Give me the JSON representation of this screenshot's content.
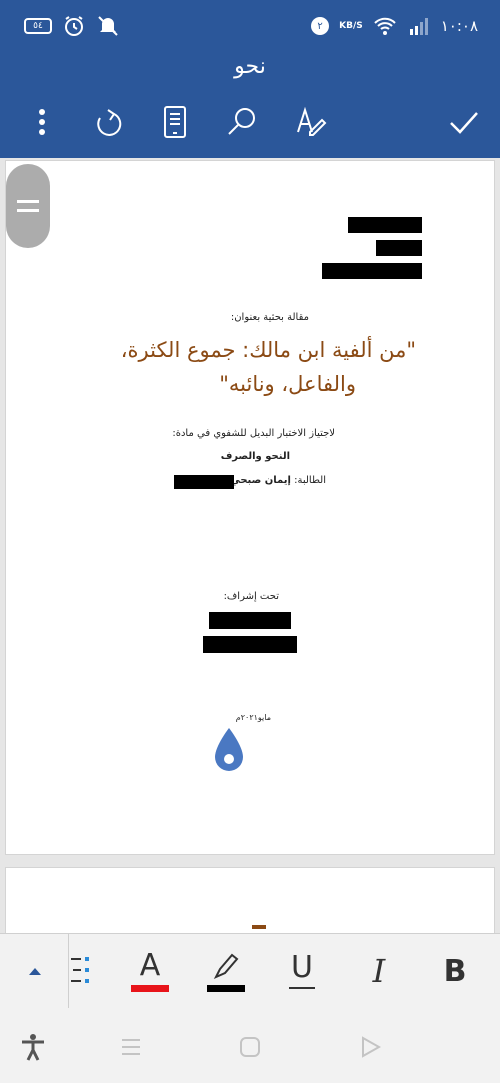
{
  "status_bar": {
    "battery": "٥٤",
    "badge": "٢",
    "speed_unit": "KB/S",
    "time": "١٠:٠٨"
  },
  "document_title": "نحو",
  "document": {
    "label_article": "مقالة بحثية بعنوان:",
    "title_line1": "\"من ألفية ابن مالك: جموع الكثرة،",
    "title_line2": "والفاعل، ونائبه\"",
    "purpose": "لاجتياز الاختبار البديل للشفوي في مادة:",
    "subject": "النحو والصرف",
    "student_label": "الطالبة:",
    "student_name": "إيمان صبحي",
    "supervision_label": "تحت إشراف:",
    "date": "مايو٢٠٢١م"
  },
  "format_bar": {
    "underline_glyph": "U",
    "italic_glyph": "I",
    "bold_glyph": "B",
    "font_color_glyph": "A",
    "font_color": "#e8141a",
    "highlight_color": "#000000"
  },
  "colors": {
    "brand": "#2b579a",
    "title_color": "#8b4a14",
    "cursor_color": "#4a78c2"
  }
}
